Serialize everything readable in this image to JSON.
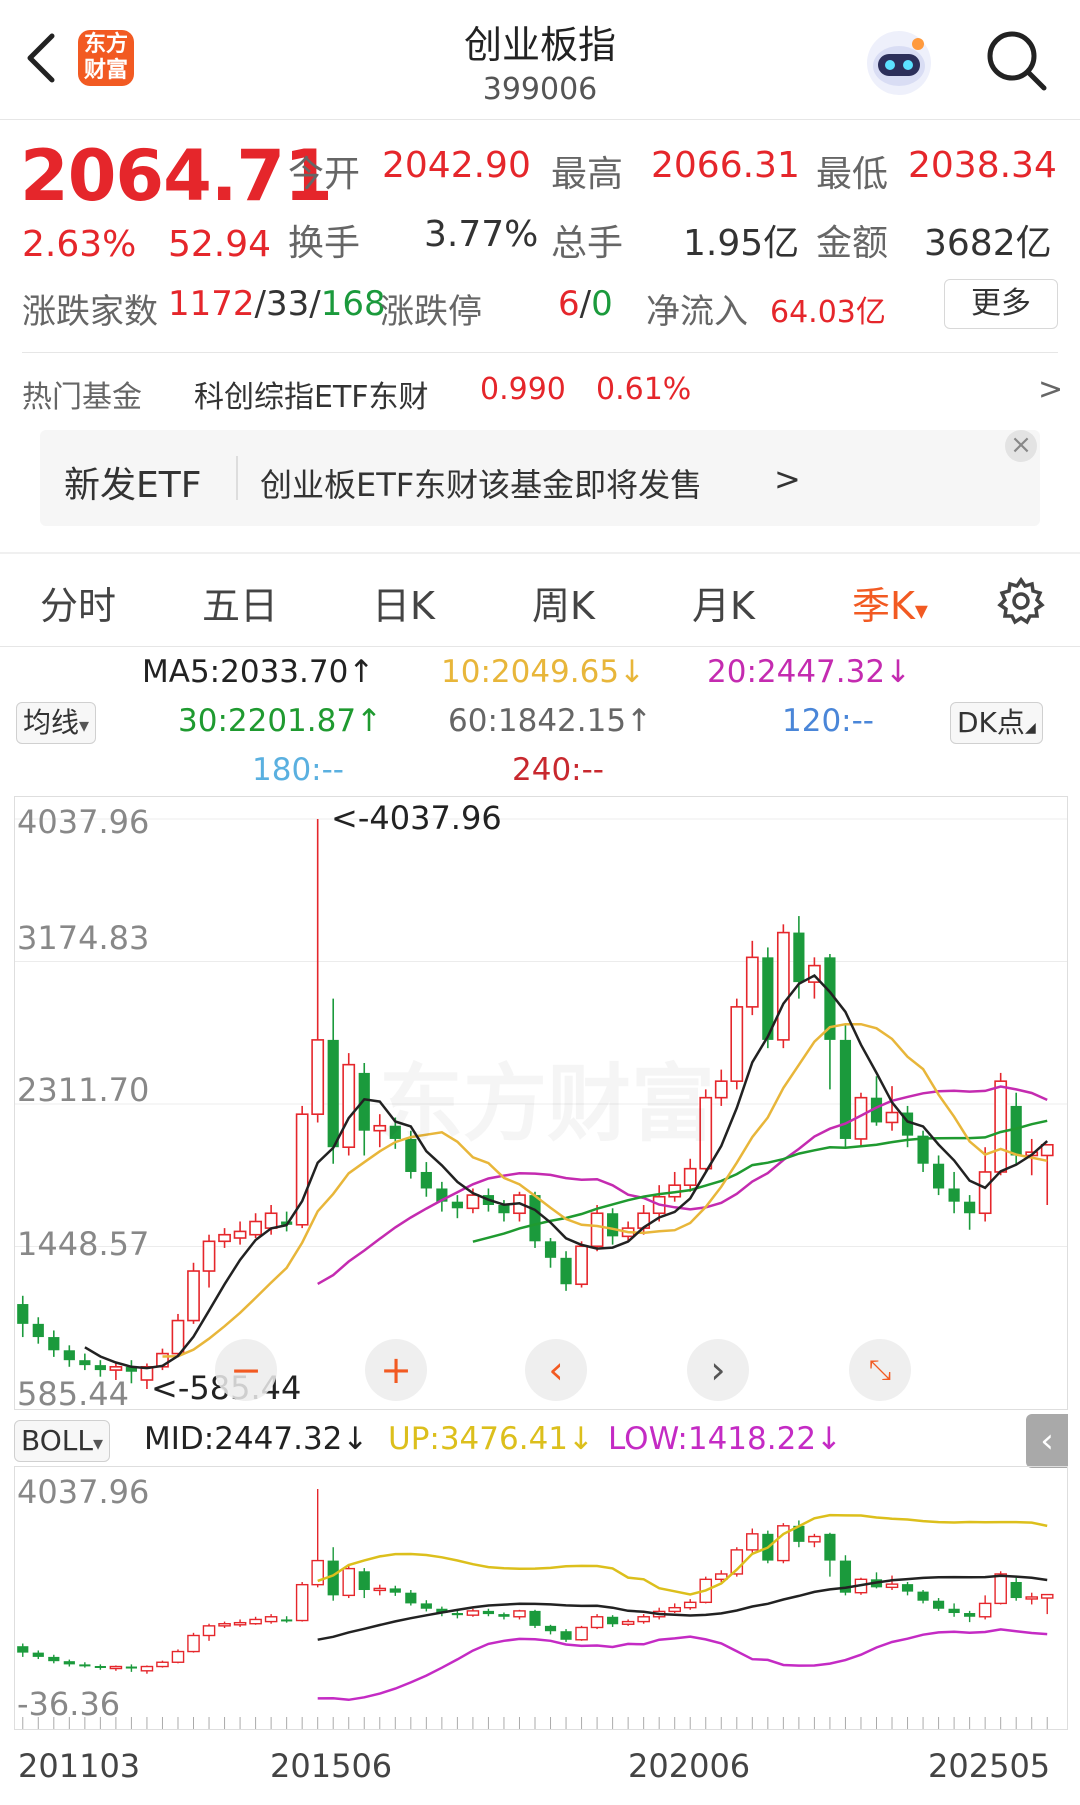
{
  "header": {
    "back_icon": "chevron-left-icon",
    "logo_text": "东方\n财富",
    "title": "创业板指",
    "code": "399006",
    "assistant_icon": "robot-avatar-icon",
    "search_icon": "search-icon"
  },
  "quote": {
    "price": "2064.71",
    "change_pct": "2.63%",
    "change": "52.94",
    "open_label": "今开",
    "open": "2042.90",
    "high_label": "最高",
    "high": "2066.31",
    "low_label": "最低",
    "low": "2038.34",
    "turnover_label": "换手",
    "turnover": "3.77%",
    "volume_label": "总手",
    "volume": "1.95亿",
    "amount_label": "金额",
    "amount": "3682亿",
    "breadth_label": "涨跌家数",
    "breadth_up": "1172",
    "breadth_slash1": "/",
    "breadth_flat": "33",
    "breadth_slash2": "/",
    "breadth_down": "168",
    "limit_label": "涨跌停",
    "limit_up": "6",
    "limit_slash": "/",
    "limit_down": "0",
    "netflow_label": "净流入",
    "netflow": "64.03亿",
    "more_label": "更多"
  },
  "fund": {
    "label": "热门基金",
    "name": "科创综指ETF东财",
    "price": "0.990",
    "pct": "0.61%",
    "arrow": ">"
  },
  "banner": {
    "tag": "新发ETF",
    "text": "创业板ETF东财该基金即将发售",
    "arrow": ">",
    "close": "×"
  },
  "tabs": [
    {
      "label": "分时"
    },
    {
      "label": "五日"
    },
    {
      "label": "日K"
    },
    {
      "label": "周K"
    },
    {
      "label": "月K"
    },
    {
      "label": "季K"
    }
  ],
  "tab_active_arrow": "▾",
  "settings_icon": "gear-icon",
  "ma": {
    "selector": "均线",
    "selector_arrow": "▾",
    "ma5": "MA5:2033.70↑",
    "ma10": "10:2049.65↓",
    "ma20": "20:2447.32↓",
    "ma30": "30:2201.87↑",
    "ma60": "60:1842.15↑",
    "ma120": "120:--",
    "ma180": "180:--",
    "ma240": "240:--",
    "dk": "DK点",
    "dk_arrow": "◢"
  },
  "main_chart": {
    "y_labels": [
      "4037.96",
      "3174.83",
      "2311.70",
      "1448.57",
      "585.44"
    ],
    "max_label": "<-4037.96",
    "min_label": "<-585.44",
    "watermark": "东方财富"
  },
  "boll": {
    "selector": "BOLL",
    "selector_arrow": "▾",
    "mid": "MID:2447.32↓",
    "up": "UP:3476.41↓",
    "low": "LOW:1418.22↓",
    "collapse_icon": "chevron-left-icon",
    "y_top": "4037.96",
    "y_bottom": "-36.36"
  },
  "x_labels": [
    "201103",
    "201506",
    "202006",
    "202505"
  ],
  "controls": [
    "minus-icon",
    "plus-icon",
    "chevron-left-icon",
    "chevron-right-icon",
    "expand-icon"
  ],
  "colors": {
    "up": "#e5262b",
    "down": "#1b9a3c",
    "ma5": "#222222",
    "ma10": "#e8b63a",
    "ma20": "#c42bb0",
    "ma30": "#1f9a30",
    "ma60": "#666666",
    "ma120": "#4a86d8",
    "ma180": "#5ab0e0",
    "ma240": "#c8282e",
    "boll_up": "#dcbf1c",
    "boll_low": "#c42bc4",
    "accent": "#f25a22"
  },
  "chart_data": {
    "type": "candlestick",
    "period": "quarterly",
    "candles": [
      {
        "o": 1100,
        "c": 980,
        "h": 1150,
        "l": 900
      },
      {
        "o": 980,
        "c": 900,
        "h": 1020,
        "l": 860
      },
      {
        "o": 900,
        "c": 820,
        "h": 940,
        "l": 780
      },
      {
        "o": 820,
        "c": 760,
        "h": 850,
        "l": 720
      },
      {
        "o": 760,
        "c": 730,
        "h": 800,
        "l": 700
      },
      {
        "o": 730,
        "c": 700,
        "h": 760,
        "l": 660
      },
      {
        "o": 700,
        "c": 720,
        "h": 740,
        "l": 640
      },
      {
        "o": 720,
        "c": 690,
        "h": 760,
        "l": 620
      },
      {
        "o": 640,
        "c": 720,
        "h": 740,
        "l": 585.44
      },
      {
        "o": 720,
        "c": 800,
        "h": 830,
        "l": 700
      },
      {
        "o": 800,
        "c": 1000,
        "h": 1040,
        "l": 780
      },
      {
        "o": 1000,
        "c": 1300,
        "h": 1350,
        "l": 980
      },
      {
        "o": 1300,
        "c": 1480,
        "h": 1520,
        "l": 1200
      },
      {
        "o": 1480,
        "c": 1520,
        "h": 1560,
        "l": 1440
      },
      {
        "o": 1500,
        "c": 1540,
        "h": 1600,
        "l": 1460
      },
      {
        "o": 1520,
        "c": 1600,
        "h": 1650,
        "l": 1500
      },
      {
        "o": 1560,
        "c": 1650,
        "h": 1700,
        "l": 1520
      },
      {
        "o": 1600,
        "c": 1580,
        "h": 1660,
        "l": 1540
      },
      {
        "o": 1580,
        "c": 2250,
        "h": 2300,
        "l": 1560
      },
      {
        "o": 2250,
        "c": 2700,
        "h": 4037.96,
        "l": 2200
      },
      {
        "o": 2700,
        "c": 2050,
        "h": 2950,
        "l": 1950
      },
      {
        "o": 2050,
        "c": 2550,
        "h": 2620,
        "l": 2000
      },
      {
        "o": 2500,
        "c": 2150,
        "h": 2560,
        "l": 2000
      },
      {
        "o": 2150,
        "c": 2180,
        "h": 2250,
        "l": 2050
      },
      {
        "o": 2180,
        "c": 2100,
        "h": 2230,
        "l": 2040
      },
      {
        "o": 2100,
        "c": 1900,
        "h": 2150,
        "l": 1860
      },
      {
        "o": 1900,
        "c": 1800,
        "h": 1960,
        "l": 1750
      },
      {
        "o": 1800,
        "c": 1720,
        "h": 1840,
        "l": 1660
      },
      {
        "o": 1720,
        "c": 1680,
        "h": 1760,
        "l": 1620
      },
      {
        "o": 1680,
        "c": 1760,
        "h": 1800,
        "l": 1650
      },
      {
        "o": 1760,
        "c": 1700,
        "h": 1800,
        "l": 1660
      },
      {
        "o": 1700,
        "c": 1650,
        "h": 1730,
        "l": 1600
      },
      {
        "o": 1650,
        "c": 1760,
        "h": 1780,
        "l": 1600
      },
      {
        "o": 1760,
        "c": 1480,
        "h": 1780,
        "l": 1440
      },
      {
        "o": 1480,
        "c": 1380,
        "h": 1500,
        "l": 1320
      },
      {
        "o": 1380,
        "c": 1220,
        "h": 1420,
        "l": 1180
      },
      {
        "o": 1220,
        "c": 1450,
        "h": 1480,
        "l": 1200
      },
      {
        "o": 1450,
        "c": 1650,
        "h": 1700,
        "l": 1420
      },
      {
        "o": 1650,
        "c": 1510,
        "h": 1680,
        "l": 1460
      },
      {
        "o": 1510,
        "c": 1560,
        "h": 1600,
        "l": 1480
      },
      {
        "o": 1560,
        "c": 1650,
        "h": 1700,
        "l": 1520
      },
      {
        "o": 1650,
        "c": 1750,
        "h": 1820,
        "l": 1600
      },
      {
        "o": 1750,
        "c": 1820,
        "h": 1900,
        "l": 1720
      },
      {
        "o": 1820,
        "c": 1920,
        "h": 1980,
        "l": 1780
      },
      {
        "o": 1920,
        "c": 2350,
        "h": 2400,
        "l": 1900
      },
      {
        "o": 2350,
        "c": 2450,
        "h": 2520,
        "l": 2300
      },
      {
        "o": 2450,
        "c": 2900,
        "h": 2950,
        "l": 2400
      },
      {
        "o": 2900,
        "c": 3200,
        "h": 3300,
        "l": 2850
      },
      {
        "o": 3200,
        "c": 2700,
        "h": 3260,
        "l": 2650
      },
      {
        "o": 2700,
        "c": 3350,
        "h": 3400,
        "l": 2650
      },
      {
        "o": 3350,
        "c": 3050,
        "h": 3450,
        "l": 2950
      },
      {
        "o": 3050,
        "c": 3150,
        "h": 3200,
        "l": 2950
      },
      {
        "o": 3200,
        "c": 2700,
        "h": 3220,
        "l": 2400
      },
      {
        "o": 2700,
        "c": 2100,
        "h": 2800,
        "l": 2050
      },
      {
        "o": 2100,
        "c": 2350,
        "h": 2380,
        "l": 2060
      },
      {
        "o": 2350,
        "c": 2200,
        "h": 2480,
        "l": 2180
      },
      {
        "o": 2200,
        "c": 2260,
        "h": 2420,
        "l": 2150
      },
      {
        "o": 2260,
        "c": 2120,
        "h": 2300,
        "l": 2050
      },
      {
        "o": 2120,
        "c": 1950,
        "h": 2150,
        "l": 1900
      },
      {
        "o": 1950,
        "c": 1800,
        "h": 2000,
        "l": 1760
      },
      {
        "o": 1800,
        "c": 1720,
        "h": 1900,
        "l": 1650
      },
      {
        "o": 1720,
        "c": 1650,
        "h": 1760,
        "l": 1550
      },
      {
        "o": 1650,
        "c": 1900,
        "h": 2050,
        "l": 1600
      },
      {
        "o": 1900,
        "c": 2450,
        "h": 2500,
        "l": 1880
      },
      {
        "o": 2300,
        "c": 2000,
        "h": 2380,
        "l": 1950
      },
      {
        "o": 2000,
        "c": 2020,
        "h": 2100,
        "l": 1880
      },
      {
        "o": 2000,
        "c": 2064.71,
        "h": 2066.31,
        "l": 1700
      }
    ]
  }
}
